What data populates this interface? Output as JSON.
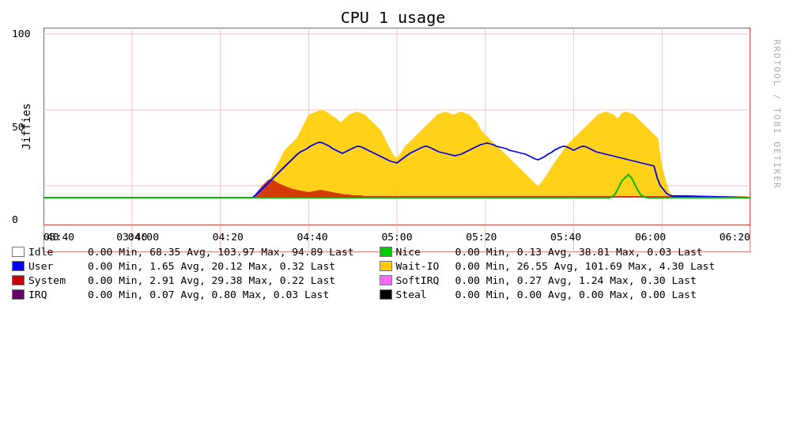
{
  "title": "CPU 1 usage",
  "watermark": "RRDTOOL / TOBI OETIKER",
  "yaxis_label": "Jiffies",
  "chart": {
    "bg_color": "#ffffff",
    "grid_color": "#ff9999",
    "border_color": "#cc0000",
    "x_labels": [
      "03:40",
      "04:00",
      "04:20",
      "04:40",
      "05:00",
      "05:20",
      "05:40",
      "06:00",
      "06:20"
    ],
    "y_labels": [
      "0",
      "50",
      "100"
    ],
    "y_max": 130
  },
  "legend": [
    {
      "name": "Idle",
      "color": "#ffffff",
      "border": "#888",
      "min": "0.00 Min,",
      "avg": "68.35 Avg,",
      "max": "103.97 Max,",
      "last": "94.89 Last"
    },
    {
      "name": "Nice",
      "color": "#00cc00",
      "border": "#888",
      "min": "0.00 Min,",
      "avg": "0.13 Avg,",
      "max": "38.81 Max,",
      "last": "0.03 Last"
    },
    {
      "name": "User",
      "color": "#0000ff",
      "border": "#888",
      "min": "0.00 Min,",
      "avg": "1.65 Avg,",
      "max": "20.12 Max,",
      "last": "0.32 Last"
    },
    {
      "name": "Wait-IO",
      "color": "#ffcc00",
      "border": "#888",
      "min": "0.00 Min,",
      "avg": "26.55 Avg,",
      "max": "101.69 Max,",
      "last": "4.30 Last"
    },
    {
      "name": "System",
      "color": "#cc0000",
      "border": "#888",
      "min": "0.00 Min,",
      "avg": "2.91 Avg,",
      "max": "29.38 Max,",
      "last": "0.22 Last"
    },
    {
      "name": "SoftIRQ",
      "color": "#ff66ff",
      "border": "#888",
      "min": "0.00 Min,",
      "avg": "0.27 Avg,",
      "max": "1.24 Max,",
      "last": "0.30 Last"
    },
    {
      "name": "IRQ",
      "color": "#660066",
      "border": "#888",
      "min": "0.00 Min,",
      "avg": "0.07 Avg,",
      "max": "0.80 Max,",
      "last": "0.03 Last"
    },
    {
      "name": "Steal",
      "color": "#000000",
      "border": "#888",
      "min": "0.00 Min,",
      "avg": "0.00 Avg,",
      "max": "0.00 Max,",
      "last": "0.00 Last"
    }
  ]
}
